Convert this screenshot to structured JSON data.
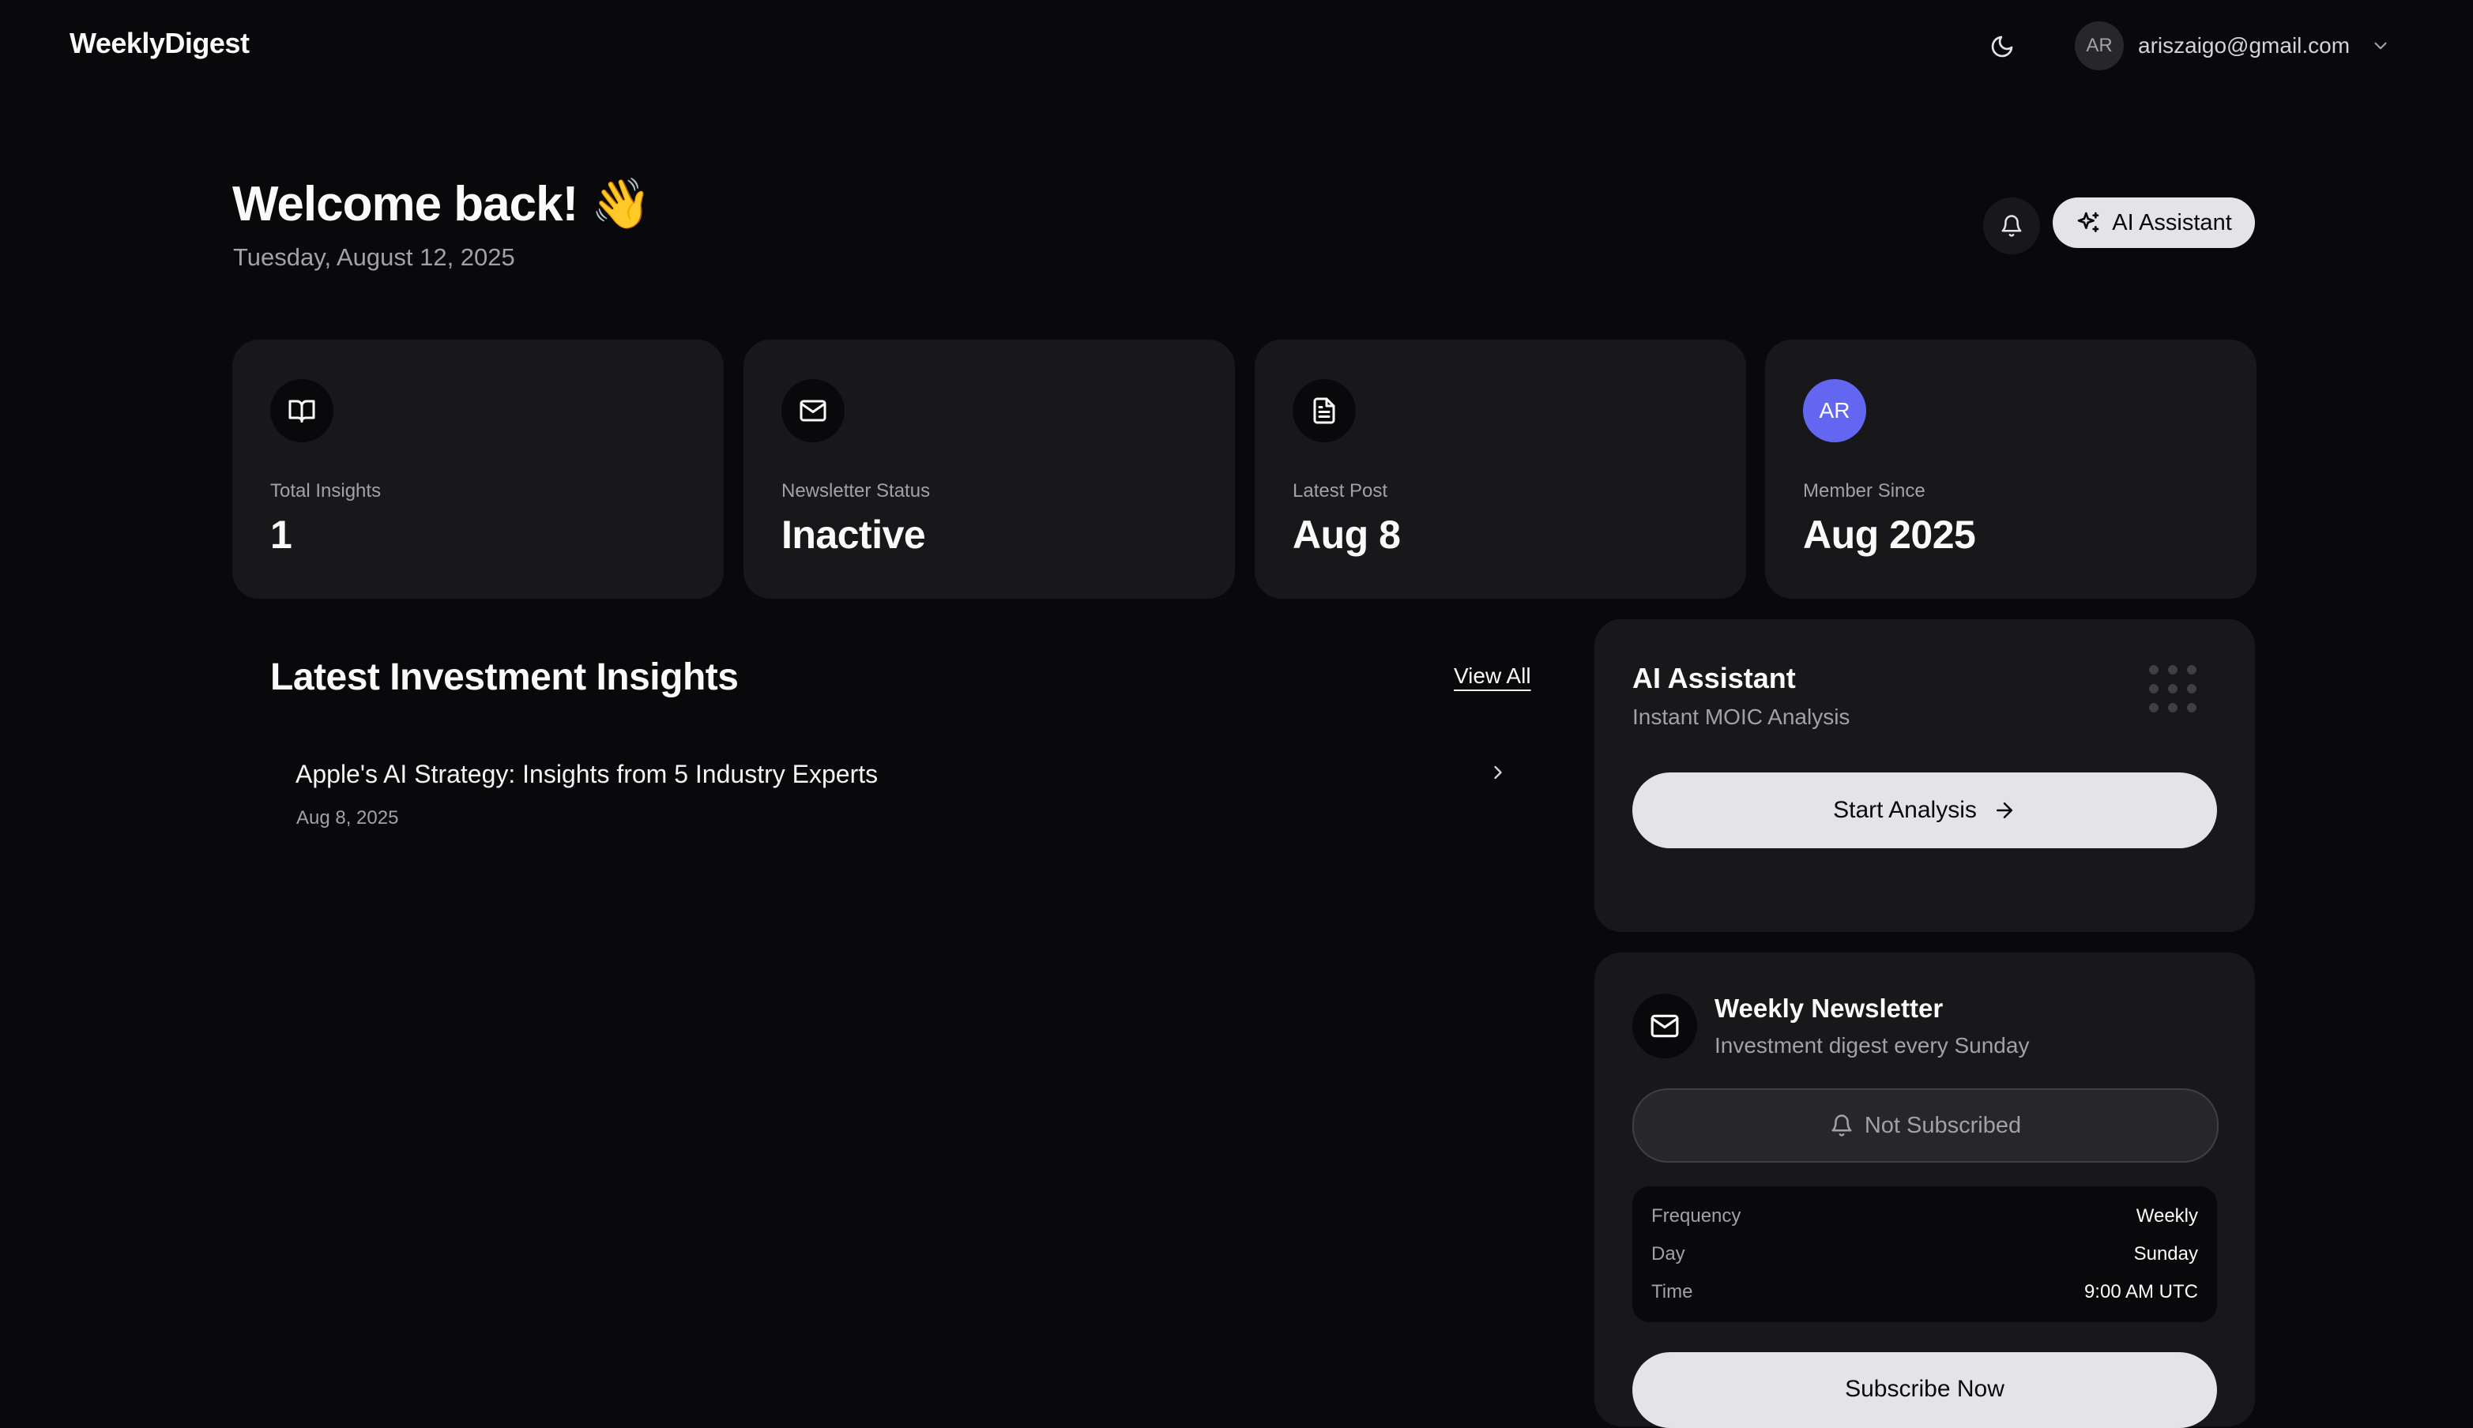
{
  "header": {
    "brand": "WeeklyDigest",
    "theme_icon": "moon-icon",
    "account": {
      "initials": "AR",
      "email": "ariszaigo@gmail.com",
      "chevron_icon": "chevron-down-icon"
    }
  },
  "welcome": {
    "title": "Welcome back! 👋",
    "date": "Tuesday, August 12, 2025",
    "notification_icon": "bell-icon",
    "ai_button_label": "AI Assistant",
    "ai_button_icon": "sparkles-icon"
  },
  "stats": [
    {
      "icon": "book-open-icon",
      "label": "Total Insights",
      "value": "1"
    },
    {
      "icon": "mail-icon",
      "label": "Newsletter Status",
      "value": "Inactive"
    },
    {
      "icon": "file-text-icon",
      "label": "Latest Post",
      "value": "Aug 8"
    },
    {
      "avatar": "AR",
      "label": "Member Since",
      "value": "Aug 2025",
      "avatar_color": "#6366f1"
    }
  ],
  "insights": {
    "title": "Latest Investment Insights",
    "view_all": "View All",
    "items": [
      {
        "title": "Apple's AI Strategy: Insights from 5 Industry Experts",
        "date": "Aug 8, 2025"
      }
    ]
  },
  "ai_card": {
    "title": "AI Assistant",
    "subtitle": "Instant MOIC Analysis",
    "button_label": "Start Analysis"
  },
  "newsletter": {
    "title": "Weekly Newsletter",
    "subtitle": "Investment digest every Sunday",
    "status": "Not Subscribed",
    "details": [
      {
        "label": "Frequency",
        "value": "Weekly"
      },
      {
        "label": "Day",
        "value": "Sunday"
      },
      {
        "label": "Time",
        "value": "9:00 AM UTC"
      }
    ],
    "subscribe_label": "Subscribe Now"
  },
  "colors": {
    "background": "#09090b",
    "card": "#18181b",
    "accent_button": "#e4e4e7",
    "avatar": "#6366f1"
  }
}
